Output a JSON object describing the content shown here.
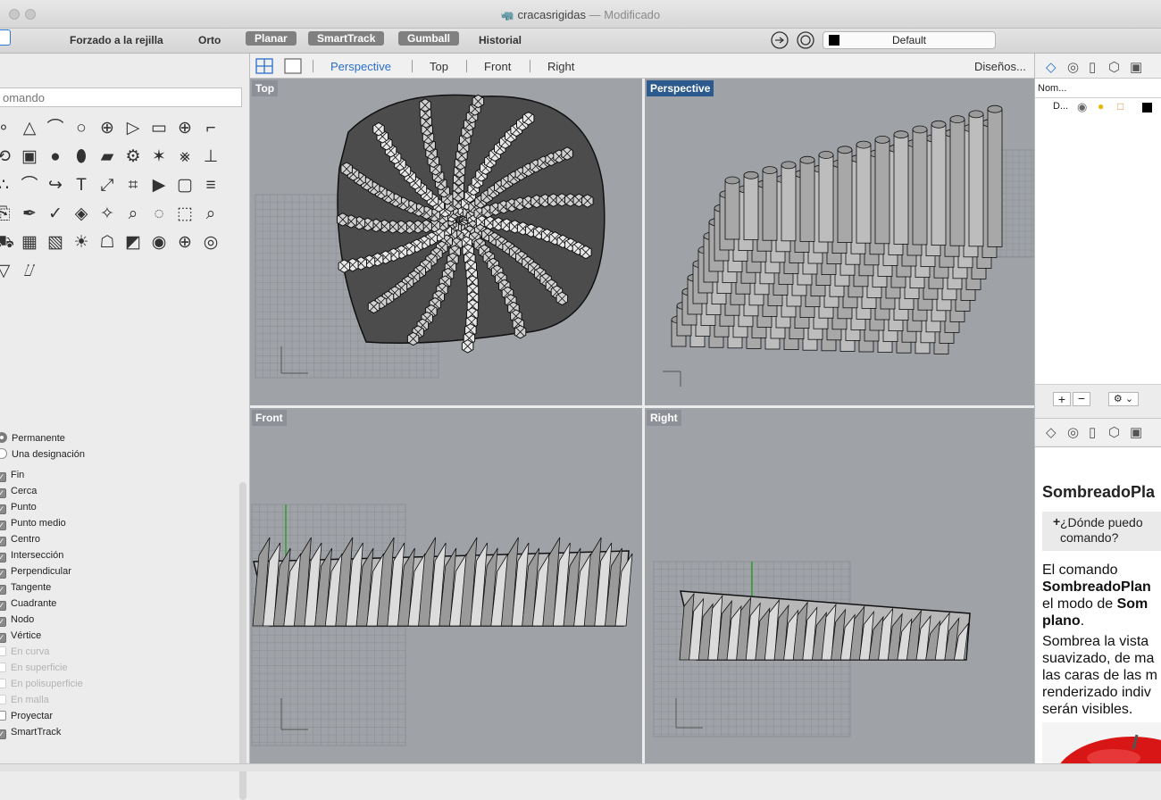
{
  "window": {
    "title": "cracasrigidas",
    "title_separator": " — ",
    "status": "Modificado",
    "file_icon": "rhino-file-icon"
  },
  "toolbar": {
    "grid_snap": "Forzado a la rejilla",
    "ortho": "Orto",
    "planar": "Planar",
    "smarttrack": "SmartTrack",
    "gumball": "Gumball",
    "history": "Historial",
    "layer": "Default",
    "layer_color": "#000000"
  },
  "viewport_tabs": {
    "tabs": [
      "Perspective",
      "Top",
      "Front",
      "Right"
    ],
    "active": "Perspective",
    "layouts": "Diseños..."
  },
  "viewports": {
    "top": "Top",
    "perspective": "Perspective",
    "front": "Front",
    "right": "Right"
  },
  "command": {
    "placeholder": "omando"
  },
  "osnap": {
    "mode": [
      {
        "label": "Permanente",
        "selected": true
      },
      {
        "label": "Una designación",
        "selected": false
      }
    ],
    "items": [
      {
        "label": "Fin",
        "checked": true,
        "enabled": true
      },
      {
        "label": "Cerca",
        "checked": true,
        "enabled": true
      },
      {
        "label": "Punto",
        "checked": true,
        "enabled": true
      },
      {
        "label": "Punto medio",
        "checked": true,
        "enabled": true
      },
      {
        "label": "Centro",
        "checked": true,
        "enabled": true
      },
      {
        "label": "Intersección",
        "checked": true,
        "enabled": true
      },
      {
        "label": "Perpendicular",
        "checked": true,
        "enabled": true
      },
      {
        "label": "Tangente",
        "checked": true,
        "enabled": true
      },
      {
        "label": "Cuadrante",
        "checked": true,
        "enabled": true
      },
      {
        "label": "Nodo",
        "checked": true,
        "enabled": true
      },
      {
        "label": "Vértice",
        "checked": true,
        "enabled": true
      },
      {
        "label": "En curva",
        "checked": false,
        "enabled": false
      },
      {
        "label": "En superficie",
        "checked": false,
        "enabled": false
      },
      {
        "label": "En polisuperficie",
        "checked": false,
        "enabled": false
      },
      {
        "label": "En malla",
        "checked": false,
        "enabled": false
      },
      {
        "label": "Proyectar",
        "checked": false,
        "enabled": true
      },
      {
        "label": "SmartTrack",
        "checked": true,
        "enabled": true
      }
    ]
  },
  "layers_panel": {
    "column_name": "Nom...",
    "layer_name": "D...",
    "layer_color": "#000000"
  },
  "help_panel": {
    "title": "SombreadoPla",
    "question": "¿Dónde puedo",
    "question_line2": "comando?",
    "p1_line1": "El comando",
    "p1_bold": "SombreadoPlan",
    "p1_line3a": "el modo de ",
    "p1_line3b": "Som",
    "p1_line4": "plano",
    "p1_line4end": ".",
    "p2": [
      "Sombrea la vista",
      "suavizado, de ma",
      "las caras de las m",
      "renderizado indiv",
      "serán visibles."
    ]
  }
}
